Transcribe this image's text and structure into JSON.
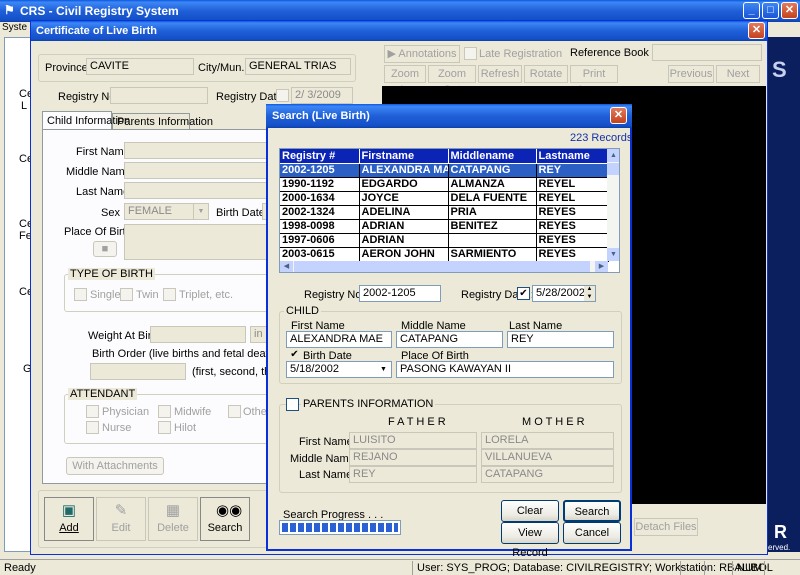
{
  "app": {
    "title": "CRS - Civil Registry System",
    "menu_stub": "Syste",
    "left_labels": [
      "Ce",
      "L",
      "Ce",
      "Ce",
      "Fe",
      "Ce",
      "G"
    ],
    "right_dark_text": "S",
    "right_bottom_text": "R",
    "right_bottom_sub": "erved."
  },
  "cert": {
    "title": "Certificate of Live Birth",
    "province_label": "Province :",
    "province_value": "CAVITE",
    "city_label": "City/Mun. :",
    "city_value": "GENERAL TRIAS",
    "registry_no_label": "Registry No. :",
    "registry_date_label": "Registry Date :",
    "registry_date_value": "2/ 3/2009",
    "tab_child": "Child Information",
    "tab_parents": "Parents Information",
    "first_name_label": "First Name :",
    "middle_name_label": "Middle Name :",
    "last_name_label": "Last Name :",
    "sex_label": "Sex :",
    "sex_value": "FEMALE",
    "birth_date_label": "Birth Date :",
    "place_of_birth_label": "Place Of Birth :",
    "type_of_birth_title": "TYPE OF BIRTH",
    "single_label": "Single",
    "twin_label": "Twin",
    "triplet_label": "Triplet, etc.",
    "weight_label": "Weight At Birth :",
    "weight_unit": "in",
    "birth_order_label": "Birth Order (live births and fetal deaths including",
    "birth_order_hint": "(first, second, third, e",
    "attendant_title": "ATTENDANT",
    "physician_label": "Physician",
    "midwife_label": "Midwife",
    "others_label": "Others",
    "nurse_label": "Nurse",
    "hilot_label": "Hilot",
    "with_attachments_label": "With Attachments",
    "tool_add": "Add",
    "tool_edit": "Edit",
    "tool_delete": "Delete",
    "tool_search": "Search",
    "annotations_label": "Annotations",
    "late_registration_label": "Late Registration",
    "reference_book_label": "Reference Book No.",
    "zoom_in": "Zoom In",
    "zoom_out": "Zoom Out",
    "refresh": "Refresh",
    "rotate": "Rotate",
    "print_image": "Print Image",
    "previous": "Previous",
    "next": "Next",
    "detach_files": "Detach Files"
  },
  "search": {
    "title": "Search (Live Birth)",
    "records": "223 Records",
    "columns": [
      "Registry #",
      "Firstname",
      "Middlename",
      "Lastname"
    ],
    "rows": [
      [
        "2002-1205",
        "ALEXANDRA MAE",
        "CATAPANG",
        "REY"
      ],
      [
        "1990-1192",
        "EDGARDO",
        "ALMANZA",
        "REYEL"
      ],
      [
        "2000-1634",
        "JOYCE",
        "DELA FUENTE",
        "REYEL"
      ],
      [
        "2002-1324",
        "ADELINA",
        "PRIA",
        "REYES"
      ],
      [
        "1998-0098",
        "ADRIAN",
        "BENITEZ",
        "REYES"
      ],
      [
        "1997-0606",
        "ADRIAN",
        "",
        "REYES"
      ],
      [
        "2003-0615",
        "AERON JOHN",
        "SARMIENTO",
        "REYES"
      ]
    ],
    "registry_no_label": "Registry No. :",
    "registry_no_value": "2002-1205",
    "registry_date_label": "Registry Date :",
    "registry_date_value": "5/28/2002",
    "child_title": "CHILD",
    "first_name_label": "First Name",
    "middle_name_label": "Middle Name",
    "last_name_label": "Last Name",
    "first_name_value": "ALEXANDRA MAE",
    "middle_name_value": "CATAPANG",
    "last_name_value": "REY",
    "birth_date_label": "Birth Date",
    "birth_date_value": "5/18/2002",
    "place_of_birth_label": "Place Of Birth",
    "place_of_birth_value": "PASONG KAWAYAN II",
    "parents_title": "PARENTS INFORMATION",
    "father_label": "F A T H E R",
    "mother_label": "M O T H E R",
    "p_first_label": "First Name :",
    "p_middle_label": "Middle Name :",
    "p_last_label": "Last Name :",
    "father_first": "LUISITO",
    "father_middle": "REJANO",
    "father_last": "REY",
    "mother_first": "LORELA",
    "mother_middle": "VILLANUEVA",
    "mother_last": "CATAPANG",
    "progress_label": "Search Progress . . .",
    "progress": 1.0,
    "clear": "Clear",
    "search": "Search",
    "view_record": "View Record",
    "cancel": "Cancel"
  },
  "status": {
    "ready": "Ready",
    "info": "User: SYS_PROG; Database: CIVILREGISTRY; Workstation: RBALIBOL",
    "num": "NUM"
  }
}
